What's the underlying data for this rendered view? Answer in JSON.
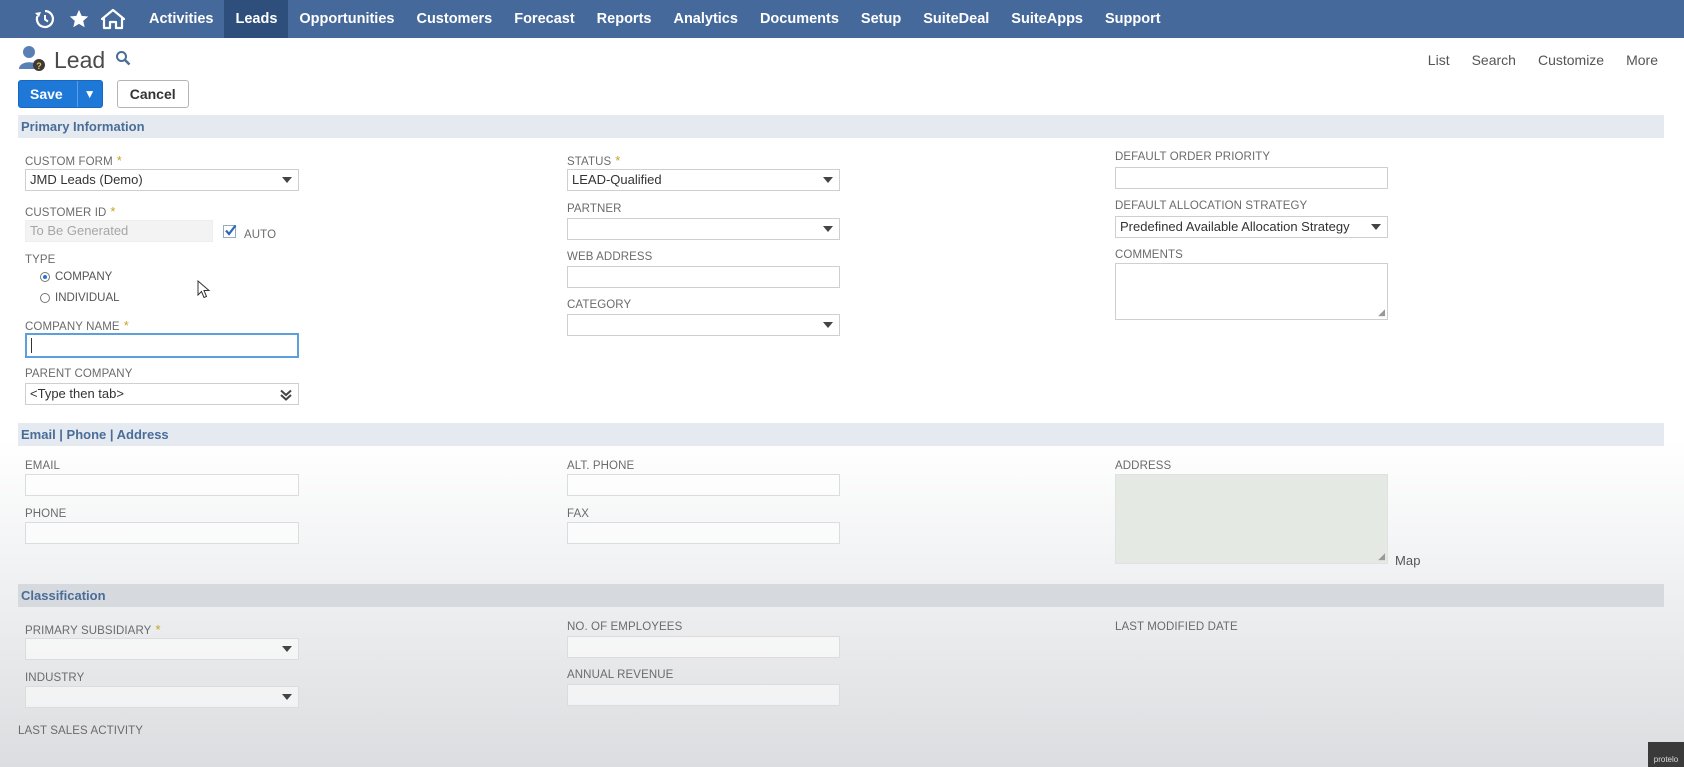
{
  "nav": {
    "items": [
      "Activities",
      "Leads",
      "Opportunities",
      "Customers",
      "Forecast",
      "Reports",
      "Analytics",
      "Documents",
      "Setup",
      "SuiteDeal",
      "SuiteApps",
      "Support"
    ],
    "active": "Leads"
  },
  "header": {
    "title": "Lead",
    "links": [
      "List",
      "Search",
      "Customize",
      "More"
    ],
    "save_label": "Save",
    "cancel_label": "Cancel"
  },
  "primary": {
    "heading": "Primary Information",
    "custom_form": {
      "label": "CUSTOM FORM",
      "value": "JMD Leads (Demo)"
    },
    "customer_id": {
      "label": "CUSTOMER ID",
      "placeholder": "To Be Generated",
      "auto_label": "AUTO"
    },
    "type": {
      "label": "TYPE",
      "options": [
        "COMPANY",
        "INDIVIDUAL"
      ],
      "selected": "COMPANY"
    },
    "company_name": {
      "label": "COMPANY NAME",
      "value": ""
    },
    "parent_company": {
      "label": "PARENT COMPANY",
      "value": "<Type then tab>"
    },
    "status": {
      "label": "STATUS",
      "value": "LEAD-Qualified"
    },
    "partner": {
      "label": "PARTNER",
      "value": ""
    },
    "web_address": {
      "label": "WEB ADDRESS",
      "value": ""
    },
    "category": {
      "label": "CATEGORY",
      "value": ""
    },
    "default_order_priority": {
      "label": "DEFAULT ORDER PRIORITY",
      "value": ""
    },
    "default_allocation_strategy": {
      "label": "DEFAULT ALLOCATION STRATEGY",
      "value": "Predefined Available Allocation Strategy"
    },
    "comments": {
      "label": "COMMENTS",
      "value": ""
    }
  },
  "contact": {
    "heading": "Email | Phone | Address",
    "email": {
      "label": "EMAIL"
    },
    "phone": {
      "label": "PHONE"
    },
    "alt_phone": {
      "label": "ALT. PHONE"
    },
    "fax": {
      "label": "FAX"
    },
    "address": {
      "label": "ADDRESS",
      "map_link": "Map"
    }
  },
  "classification": {
    "heading": "Classification",
    "primary_subsidiary": {
      "label": "PRIMARY SUBSIDIARY"
    },
    "industry": {
      "label": "INDUSTRY"
    },
    "no_of_employees": {
      "label": "NO. OF EMPLOYEES"
    },
    "annual_revenue": {
      "label": "ANNUAL REVENUE"
    },
    "last_modified_date": {
      "label": "LAST MODIFIED DATE"
    },
    "last_sales_activity": {
      "label": "LAST SALES ACTIVITY"
    }
  },
  "watermark": "protelo",
  "colors": {
    "nav": "#46699b",
    "nav_active": "#2e4f7c",
    "save": "#1e78d8",
    "section_band": "#e5eaf1",
    "required": "#c9a21f"
  }
}
